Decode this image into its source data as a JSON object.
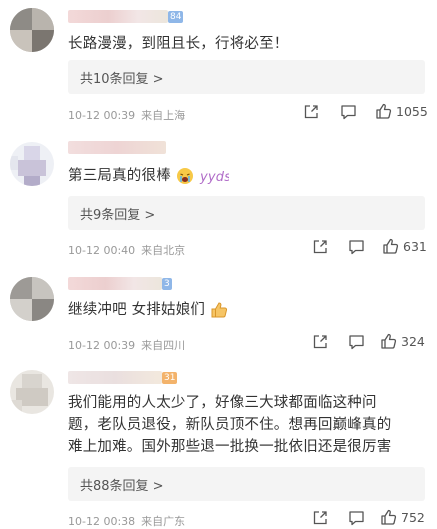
{
  "comments": [
    {
      "user_badge": "84",
      "text": "长路漫漫，到阻且长，行将必至！",
      "replies_label": "共10条回复 >",
      "date": "10-12 00:39",
      "location": "来自上海",
      "likes": "1055"
    },
    {
      "user_badge": "",
      "text": "第三局真的很棒",
      "replies_label": "共9条回复 >",
      "date": "10-12 00:40",
      "location": "来自北京",
      "likes": "631"
    },
    {
      "user_badge": "3",
      "text": "继续冲吧 女排姑娘们",
      "replies_label": "",
      "date": "10-12 00:39",
      "location": "来自四川",
      "likes": "324"
    },
    {
      "user_badge": "31",
      "text_lines": [
        "我们能用的人太少了，好像三大球都面临这种问",
        "题，老队员退役，新队员顶不住。想再回巅峰真的",
        "难上加难。国外那些退一批换一批依旧还是很厉害"
      ],
      "replies_label": "共88条回复 >",
      "date": "10-12 00:38",
      "location": "来自广东",
      "likes": "752"
    }
  ],
  "icons": [
    "share-icon",
    "comment-icon",
    "like-icon",
    "crying-emoji-icon",
    "thumbs-up-emoji-icon",
    "sticker-icon"
  ],
  "colors": {
    "badge_blue": "#8fb7e8",
    "badge_orange": "#f3b36b",
    "meta_gray": "#999999",
    "reply_bg": "#f4f4f4"
  }
}
